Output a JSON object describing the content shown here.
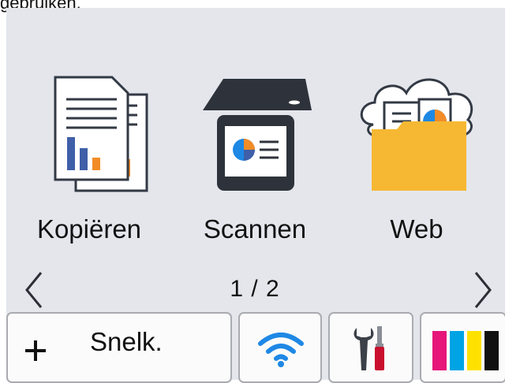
{
  "caption": "gebruiken.",
  "apps": [
    {
      "label": "Kopiëren",
      "icon": "copy-icon"
    },
    {
      "label": "Scannen",
      "icon": "scanner-icon"
    },
    {
      "label": "Web",
      "icon": "web-folder-icon"
    }
  ],
  "pager": {
    "indicator": "1 / 2",
    "prev_icon": "chevron-left-icon",
    "next_icon": "chevron-right-icon"
  },
  "bottom_bar": {
    "quick_label": "Snelk.",
    "quick_icon": "plus-icon",
    "wifi_icon": "wifi-icon",
    "settings_icon": "tools-icon",
    "ink_icon": "ink-cartridges-icon"
  },
  "colors": {
    "background": "#e4e6ec",
    "accent_blue": "#1e88e5",
    "folder_yellow": "#f6b833",
    "chart_orange": "#f28c28",
    "chart_blue": "#3f5fa8",
    "ink_magenta": "#e5157a",
    "ink_cyan": "#00a4e4",
    "ink_yellow": "#ffe100",
    "ink_black": "#111111"
  }
}
